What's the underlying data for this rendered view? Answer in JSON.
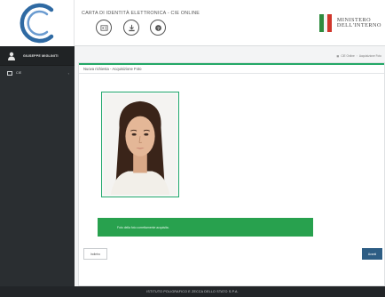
{
  "header": {
    "app_title": "CARTA DI IDENTITÀ ELETTRONICA - CIE ONLINE",
    "ministry_line1": "MINISTERO",
    "ministry_line2": "DELL'INTERNO",
    "flag_colors": [
      "#2e8b3e",
      "#f4f4f4",
      "#d0362b"
    ],
    "toolbar": [
      {
        "icon": "id-card-icon"
      },
      {
        "icon": "download-icon"
      },
      {
        "icon": "help-icon"
      }
    ]
  },
  "sidebar": {
    "user_name": "GIUSEPPE MIGLINITI",
    "items": [
      {
        "icon": "card-icon",
        "label": "CIE"
      }
    ]
  },
  "breadcrumb": {
    "items": [
      "CIE Online",
      "Acquisizione Foto"
    ]
  },
  "panel": {
    "title": "Nuova richiesta - Acquisizione Foto",
    "success_message": "Foto della foto correttamente acquisita.",
    "back_label": "Indietro",
    "next_label": "Avanti"
  },
  "footer": {
    "text": "ISTITUTO POLIGRAFICO E ZECCA DELLO STATO S.P.A."
  },
  "colors": {
    "accent_green": "#23a867",
    "success_green": "#28a14e",
    "primary_blue": "#2d5d84",
    "sidebar_dark": "#2a2e31"
  }
}
